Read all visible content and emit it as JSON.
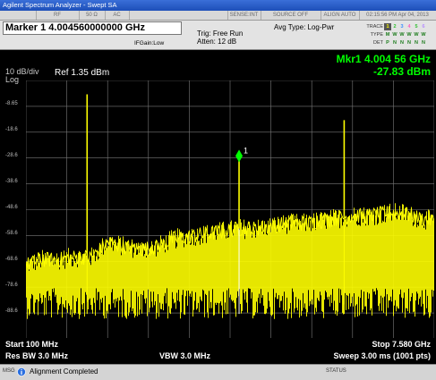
{
  "window": {
    "title": "Agilent Spectrum Analyzer - Swept SA"
  },
  "status_row": {
    "rf": "RF",
    "input_impedance": "50 Ω",
    "coupling": "AC",
    "sense": "SENSE:INT",
    "source": "SOURCE OFF",
    "align": "ALIGN AUTO",
    "datetime": "02:15:56 PM Apr 04, 2013"
  },
  "marker_bar": {
    "marker_freq": "Marker 1 4.004560000000 GHz",
    "if_gain": "IFGain:Low",
    "trig": "Trig: Free Run",
    "atten": "Atten: 12 dB",
    "avg": "Avg Type: Log-Pwr",
    "trace_label": "TRACE",
    "type_label": "TYPE",
    "det_label": "DET",
    "trace_vals": [
      "1",
      "2",
      "3",
      "4",
      "5",
      "6"
    ],
    "type_vals": [
      "M",
      "W",
      "W",
      "W",
      "W",
      "W"
    ],
    "det_vals": [
      "P",
      "N",
      "N",
      "N",
      "N",
      "N"
    ]
  },
  "display": {
    "scale_div": "10 dB/div",
    "scale_type": "Log",
    "ref_level": "Ref 1.35 dBm",
    "marker_readout_title": "Mkr1 4.004 56 GHz",
    "marker_readout_value": "-27.83 dBm",
    "marker_number": "1",
    "y_tick_labels": [
      "-8.65",
      "-18.6",
      "-28.6",
      "-38.6",
      "-48.6",
      "-58.6",
      "-68.6",
      "-78.6",
      "-88.6"
    ]
  },
  "footer": {
    "start": "Start 100 MHz",
    "stop": "Stop 7.580 GHz",
    "rbw": "Res BW 3.0 MHz",
    "vbw": "VBW 3.0 MHz",
    "sweep": "Sweep  3.00 ms (1001 pts)"
  },
  "message_bar": {
    "msg_label": "MSG",
    "message": "Alignment Completed",
    "status_label": "STATUS"
  },
  "chart_data": {
    "type": "line",
    "x_start_mhz": 100,
    "x_stop_mhz": 7580,
    "ylim": [
      -98.65,
      1.35
    ],
    "y_unit": "dBm",
    "grid": true,
    "trace_color": "#ffff00",
    "x_mhz": [
      100,
      400,
      700,
      1000,
      1300,
      1600,
      1900,
      2200,
      2500,
      2800,
      3100,
      3400,
      3700,
      4000,
      4005,
      4300,
      4600,
      4900,
      5200,
      5500,
      5800,
      6100,
      6400,
      6700,
      7000,
      7300,
      7580
    ],
    "trace_dbm": [
      -70,
      -68,
      -68,
      -67,
      -67,
      -61,
      -63,
      -64,
      -63,
      -60,
      -59,
      -58,
      -57,
      -56,
      -27.83,
      -56,
      -55,
      -54,
      -54,
      -53,
      -52,
      -51,
      -51,
      -50,
      -50,
      -52,
      -53
    ],
    "peaks": [
      {
        "x_mhz": 1220,
        "dbm": -4
      },
      {
        "x_mhz": 4004.56,
        "dbm": -27.83,
        "marker": "1"
      },
      {
        "x_mhz": 5930,
        "dbm": -14
      }
    ],
    "noise_floor_dbm": -79
  },
  "colors": {
    "trace": "#ffff00",
    "marker_text": "#00ff00",
    "grid": "#7a7a7a",
    "title_bar": "#2b5fcf"
  }
}
